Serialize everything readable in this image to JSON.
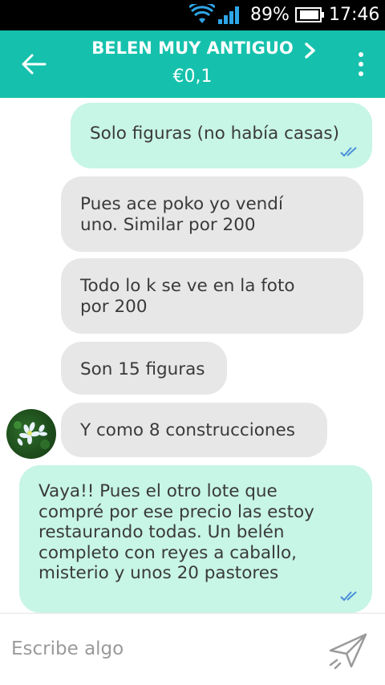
{
  "status_bar": {
    "battery_percent": "89%",
    "time": "17:46"
  },
  "header": {
    "title": "BELEN MUY ANTIGUO",
    "price": "€0,1"
  },
  "messages": [
    {
      "direction": "out",
      "text": "Solo figuras (no había casas)",
      "read": true
    },
    {
      "direction": "in",
      "text": "Pues ace poko yo vendí\nuno. Similar por 200"
    },
    {
      "direction": "in",
      "text": "Todo lo k se ve en la foto\npor 200"
    },
    {
      "direction": "in",
      "text": "Son 15 figuras"
    },
    {
      "direction": "in",
      "text": "Y como 8 construcciones"
    },
    {
      "direction": "out",
      "text": "Vaya!! Pues el otro lote que\ncompré por ese precio las estoy\nrestaurando todas. Un belén\ncompleto con reyes a caballo,\nmisterio y unos 20 pastores",
      "read": true
    }
  ],
  "composer": {
    "placeholder": "Escribe algo"
  },
  "colors": {
    "accent": "#15c1ac",
    "outgoing_bubble": "#c7f5e6",
    "incoming_bubble": "#e7e7e7",
    "read_ticks": "#4a90d9"
  },
  "icons": [
    "wifi-icon",
    "signal-icon",
    "battery-icon",
    "back-arrow-icon",
    "chevron-right-icon",
    "more-vertical-icon",
    "double-check-icon",
    "send-icon"
  ]
}
